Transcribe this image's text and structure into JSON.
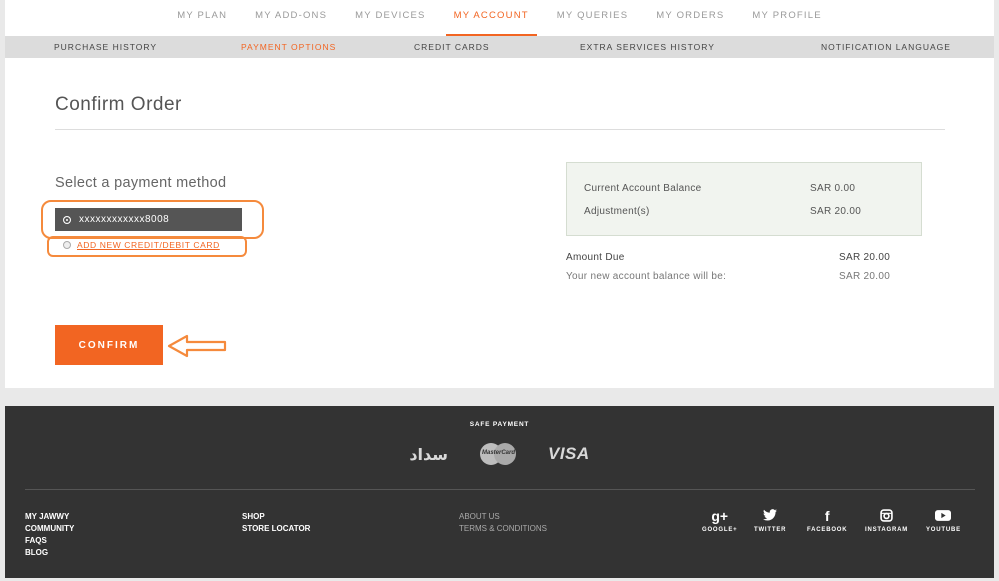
{
  "top_nav": [
    {
      "label": "MY PLAN",
      "active": false
    },
    {
      "label": "MY ADD-ONS",
      "active": false
    },
    {
      "label": "MY DEVICES",
      "active": false
    },
    {
      "label": "MY ACCOUNT",
      "active": true
    },
    {
      "label": "MY QUERIES",
      "active": false
    },
    {
      "label": "MY ORDERS",
      "active": false
    },
    {
      "label": "MY PROFILE",
      "active": false
    }
  ],
  "sub_nav": [
    {
      "label": "PURCHASE HISTORY",
      "active": false
    },
    {
      "label": "PAYMENT OPTIONS",
      "active": true
    },
    {
      "label": "CREDIT CARDS",
      "active": false
    },
    {
      "label": "EXTRA SERVICES HISTORY",
      "active": false
    },
    {
      "label": "NOTIFICATION LANGUAGE",
      "active": false
    }
  ],
  "main": {
    "title": "Confirm Order",
    "payment_heading": "Select a payment method",
    "card_option": "xxxxxxxxxxxx8008",
    "add_card_link": "ADD NEW CREDIT/DEBIT CARD",
    "confirm_label": "CONFIRM"
  },
  "balance": {
    "current_label": "Current Account Balance",
    "current_value": "SAR 0.00",
    "adjustment_label": "Adjustment(s)",
    "adjustment_value": "SAR 20.00",
    "amount_due_label": "Amount Due",
    "amount_due_value": "SAR 20.00",
    "new_balance_label": "Your new account balance will be:",
    "new_balance_value": "SAR 20.00"
  },
  "footer": {
    "safe_payment": "SAFE PAYMENT",
    "payment_logos": {
      "sadad": "سداد",
      "mastercard": "MasterCard",
      "visa": "VISA"
    },
    "col1": [
      "MY JAWWY",
      "COMMUNITY",
      "FAQS",
      "BLOG"
    ],
    "col2": [
      "SHOP",
      "STORE LOCATOR"
    ],
    "col3": [
      "ABOUT US",
      "TERMS & CONDITIONS"
    ],
    "social": [
      {
        "icon": "google-plus-icon",
        "glyph": "g+",
        "label": "GOOGLE+"
      },
      {
        "icon": "twitter-icon",
        "glyph": "🐦",
        "label": "TWITTER"
      },
      {
        "icon": "facebook-icon",
        "glyph": "f",
        "label": "FACEBOOK"
      },
      {
        "icon": "instagram-icon",
        "glyph": "◎",
        "label": "INSTAGRAM"
      },
      {
        "icon": "youtube-icon",
        "glyph": "▶",
        "label": "YOUTUBE"
      }
    ]
  },
  "colors": {
    "accent": "#f26522",
    "highlight": "#f58a3c",
    "footer_bg": "#333333"
  }
}
